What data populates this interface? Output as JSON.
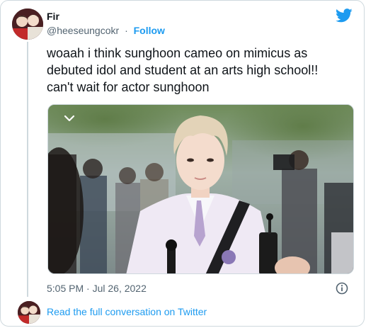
{
  "tweet": {
    "display_name": "Fir",
    "handle": "@heeseungcokr",
    "separator": "·",
    "follow_label": "Follow",
    "text": "woaah i think sunghoon cameo on mimicus as\ndebuted idol and student at an arts high school!!\ncan't wait for actor sunghoon",
    "timestamp": "5:05 PM · Jul 26, 2022",
    "read_more_label": "Read the full conversation on Twitter"
  },
  "icons": {
    "brand": "twitter-bird-icon",
    "media_toggle": "chevron-down-icon",
    "info": "info-icon"
  },
  "colors": {
    "link": "#1d9bf0",
    "secondary_text": "#536471",
    "border": "#cfd9de",
    "primary_text": "#0f1419"
  }
}
